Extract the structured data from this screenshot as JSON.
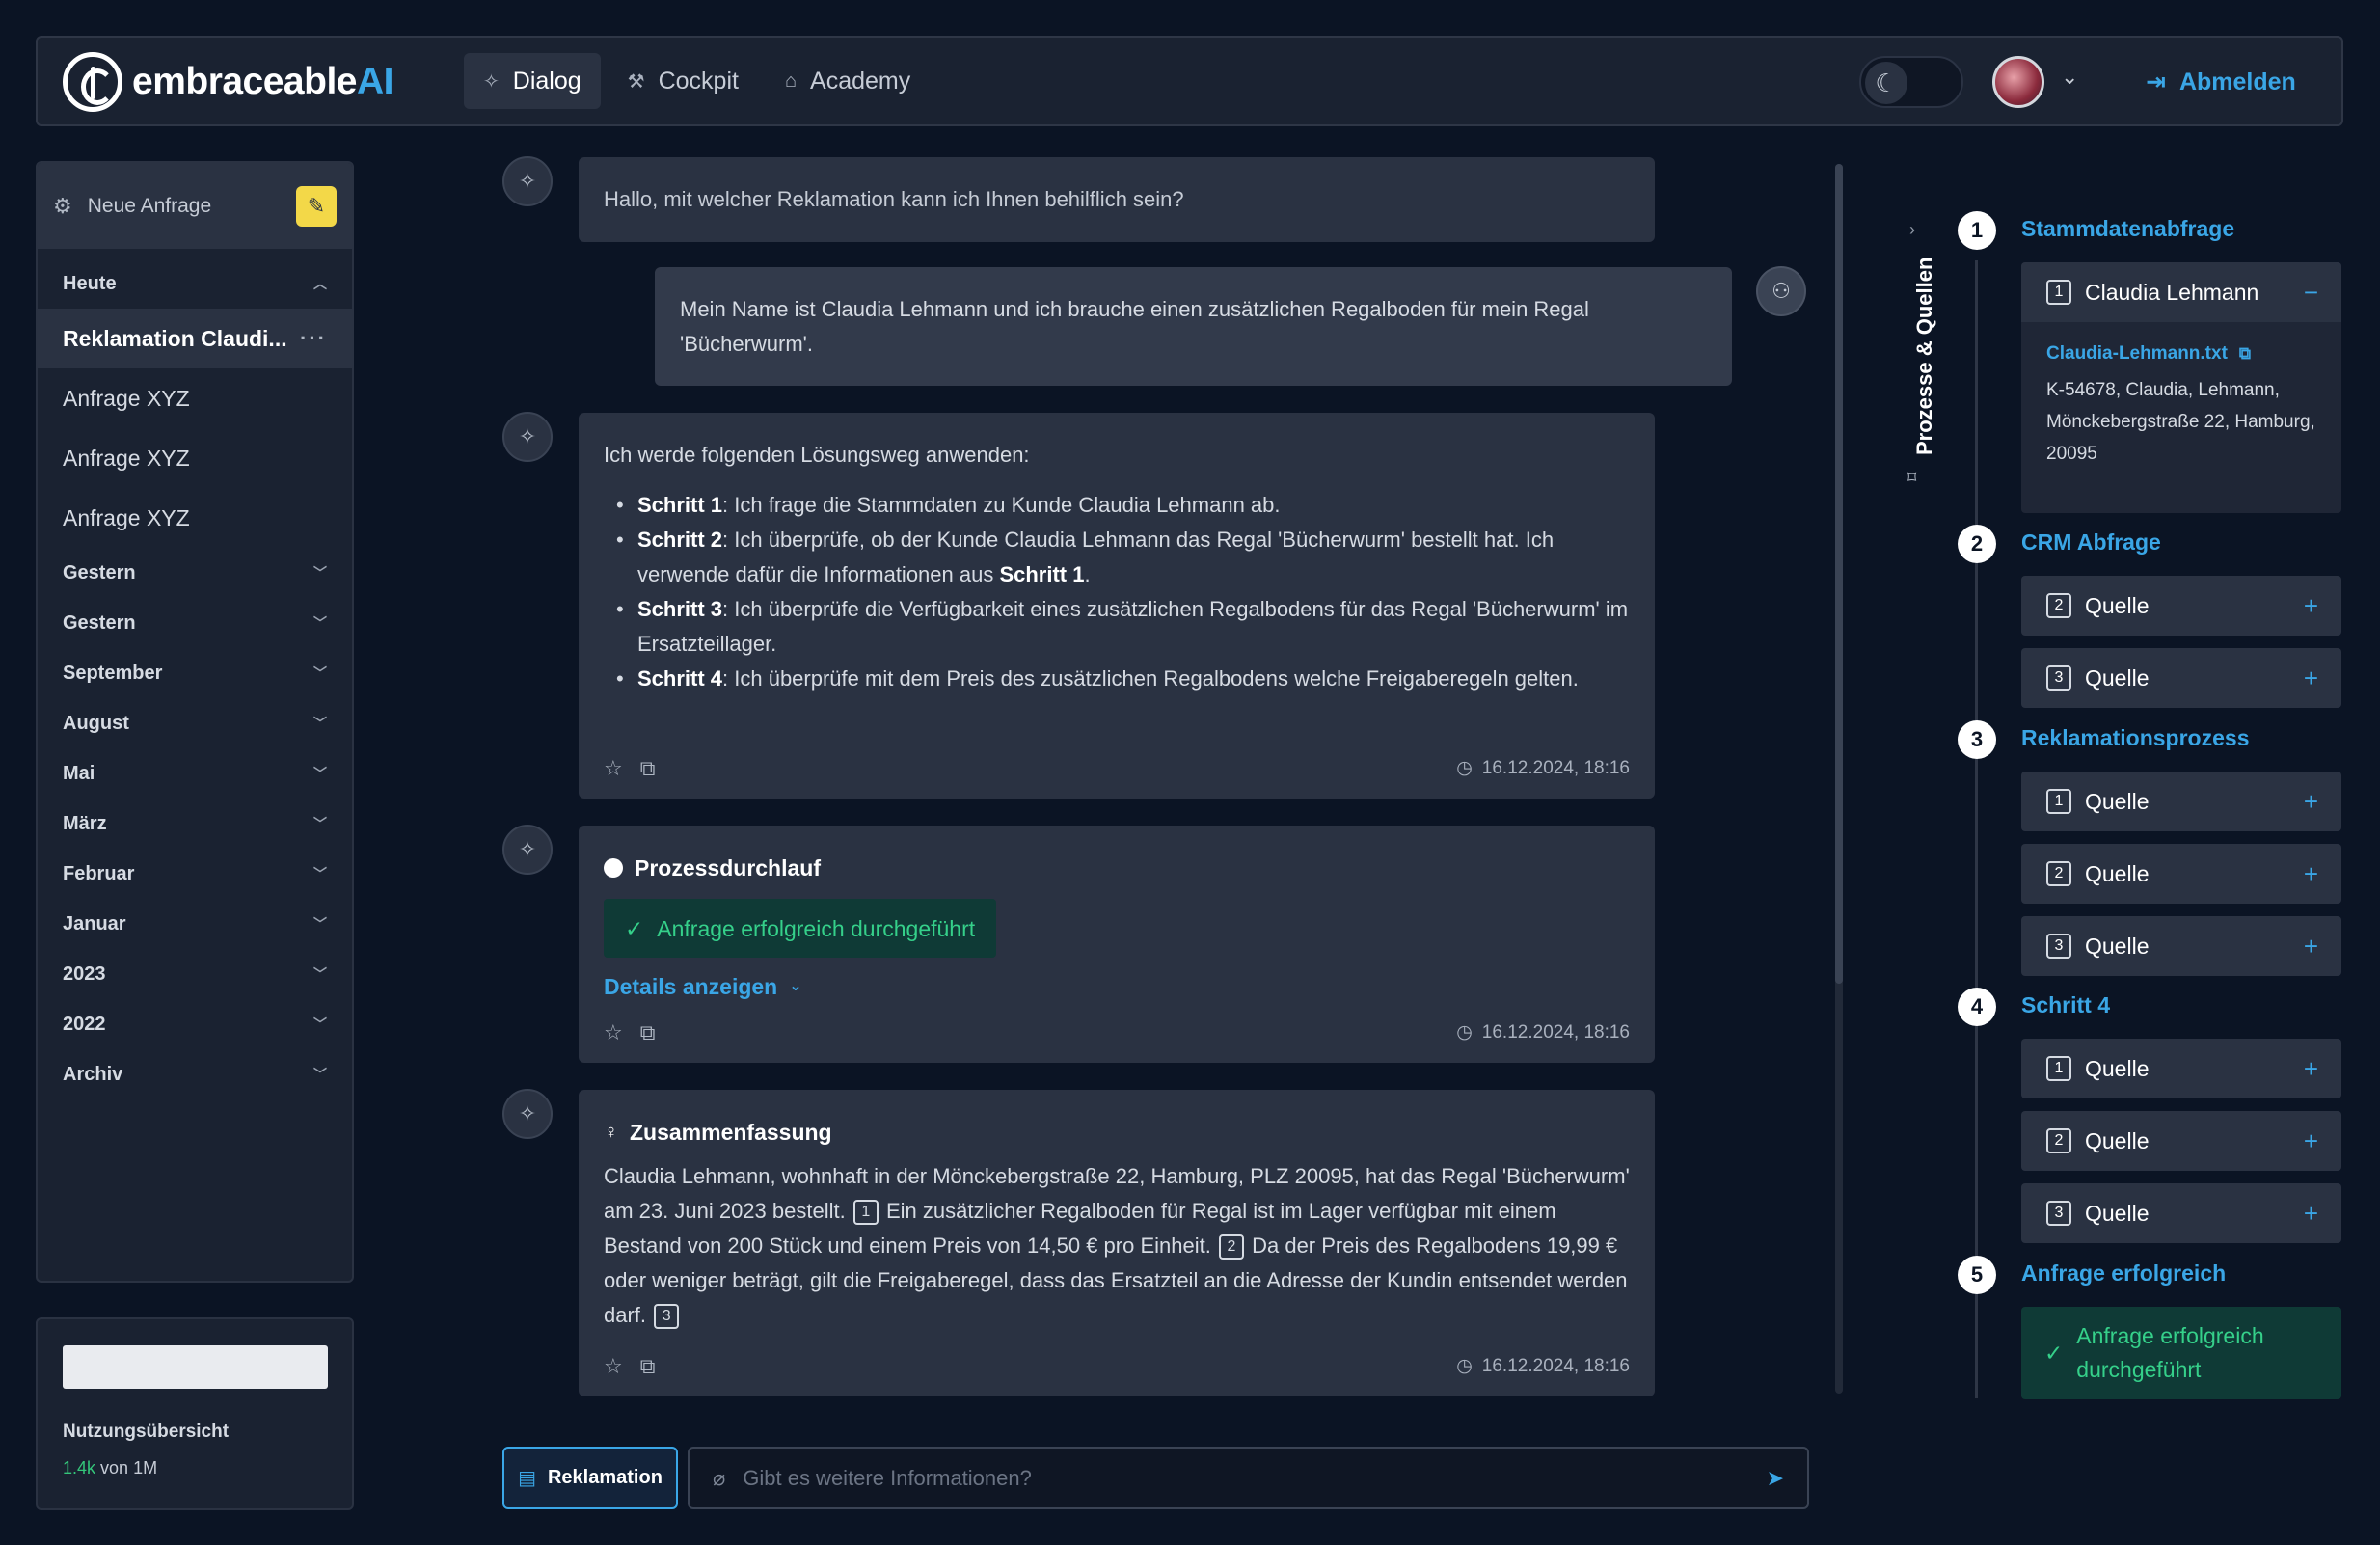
{
  "app": {
    "logo_text": "embraceable",
    "logo_accent": "AI"
  },
  "nav": {
    "tabs": [
      {
        "label": "Dialog",
        "icon": "sparkle-icon",
        "active": true
      },
      {
        "label": "Cockpit",
        "icon": "wrench-icon",
        "active": false
      },
      {
        "label": "Academy",
        "icon": "graduation-cap-icon",
        "active": false
      }
    ],
    "logout": "Abmelden"
  },
  "sidebar": {
    "new_request": "Neue Anfrage",
    "today": "Heute",
    "items": [
      {
        "label": "Reklamation Claudi...",
        "active": true
      },
      {
        "label": "Anfrage XYZ"
      },
      {
        "label": "Anfrage XYZ"
      },
      {
        "label": "Anfrage XYZ"
      }
    ],
    "groups": [
      "Gestern",
      "Gestern",
      "September",
      "August",
      "Mai",
      "März",
      "Februar",
      "Januar",
      "2023",
      "2022",
      "Archiv"
    ]
  },
  "usage": {
    "title": "Nutzungsübersicht",
    "used": "1.4k",
    "of": "von 1M"
  },
  "chat": {
    "greeting": "Hallo, mit welcher Reklamation kann ich Ihnen behilflich sein?",
    "user_message": "Mein Name ist Claudia Lehmann und ich brauche einen zusätzlichen Regalboden für mein Regal 'Bücherwurm'.",
    "plan_intro": "Ich werde folgenden Lösungsweg anwenden:",
    "steps": [
      {
        "label": "Schritt 1",
        "text": ": Ich frage die Stammdaten zu Kunde Claudia Lehmann ab."
      },
      {
        "label": "Schritt 2",
        "text": ": Ich überprüfe, ob der Kunde Claudia Lehmann das Regal 'Bücherwurm' bestellt hat. Ich verwende dafür die Informationen aus ",
        "ref": "Schritt 1",
        "after": "."
      },
      {
        "label": "Schritt 3",
        "text": ": Ich überprüfe die Verfügbarkeit eines zusätzlichen Regalbodens für das Regal 'Bücherwurm' im Ersatzteillager."
      },
      {
        "label": "Schritt 4",
        "text": ": Ich überprüfe mit dem Preis des zusätzlichen Regalbodens welche Freigaberegeln gelten."
      }
    ],
    "timestamp": "16.12.2024, 18:16",
    "process_title": "Prozessdurchlauf",
    "process_status": "Anfrage erfolgreich durchgeführt",
    "details_link": "Details anzeigen",
    "summary_title": "Zusammenfassung",
    "summary_parts": [
      "Claudia Lehmann, wohnhaft in der Mönckebergstraße 22, Hamburg, PLZ 20095, hat das Regal 'Bücherwurm' am 23. Juni 2023 bestellt.",
      "1",
      " Ein zusätzlicher Regalboden für Regal ist im Lager verfügbar mit einem Bestand von 200 Stück und einem Preis von 14,50 € pro Einheit.",
      "2",
      " Da der Preis des Regalbodens 19,99 € oder weniger beträgt, gilt die Freigaberegel, dass das Ersatzteil an die Adresse der Kundin entsendet werden darf.",
      "3"
    ],
    "tag_button": "Reklamation",
    "input_placeholder": "Gibt es weitere Informationen?"
  },
  "right_panel": {
    "tab_label": "Prozesse & Quellen",
    "steps": [
      {
        "num": "1",
        "title": "Stammdatenabfrage",
        "sources": [
          {
            "num": "1",
            "label": "Claudia Lehmann",
            "expanded": true,
            "file": "Claudia-Lehmann.txt",
            "content": "K-54678, Claudia, Lehmann, Mönckebergstraße 22, Hamburg, 20095"
          }
        ]
      },
      {
        "num": "2",
        "title": "CRM Abfrage",
        "sources": [
          {
            "num": "2",
            "label": "Quelle"
          },
          {
            "num": "3",
            "label": "Quelle"
          }
        ]
      },
      {
        "num": "3",
        "title": "Reklamationsprozess",
        "sources": [
          {
            "num": "1",
            "label": "Quelle"
          },
          {
            "num": "2",
            "label": "Quelle"
          },
          {
            "num": "3",
            "label": "Quelle"
          }
        ]
      },
      {
        "num": "4",
        "title": "Schritt 4",
        "sources": [
          {
            "num": "1",
            "label": "Quelle"
          },
          {
            "num": "2",
            "label": "Quelle"
          },
          {
            "num": "3",
            "label": "Quelle"
          }
        ]
      },
      {
        "num": "5",
        "title": "Anfrage erfolgreich",
        "result": "Anfrage erfolgreich durchgeführt"
      }
    ]
  },
  "colors": {
    "accent": "#3aa6e6",
    "success": "#35d08a",
    "highlight": "#f3d848",
    "background": "#0b1424"
  }
}
